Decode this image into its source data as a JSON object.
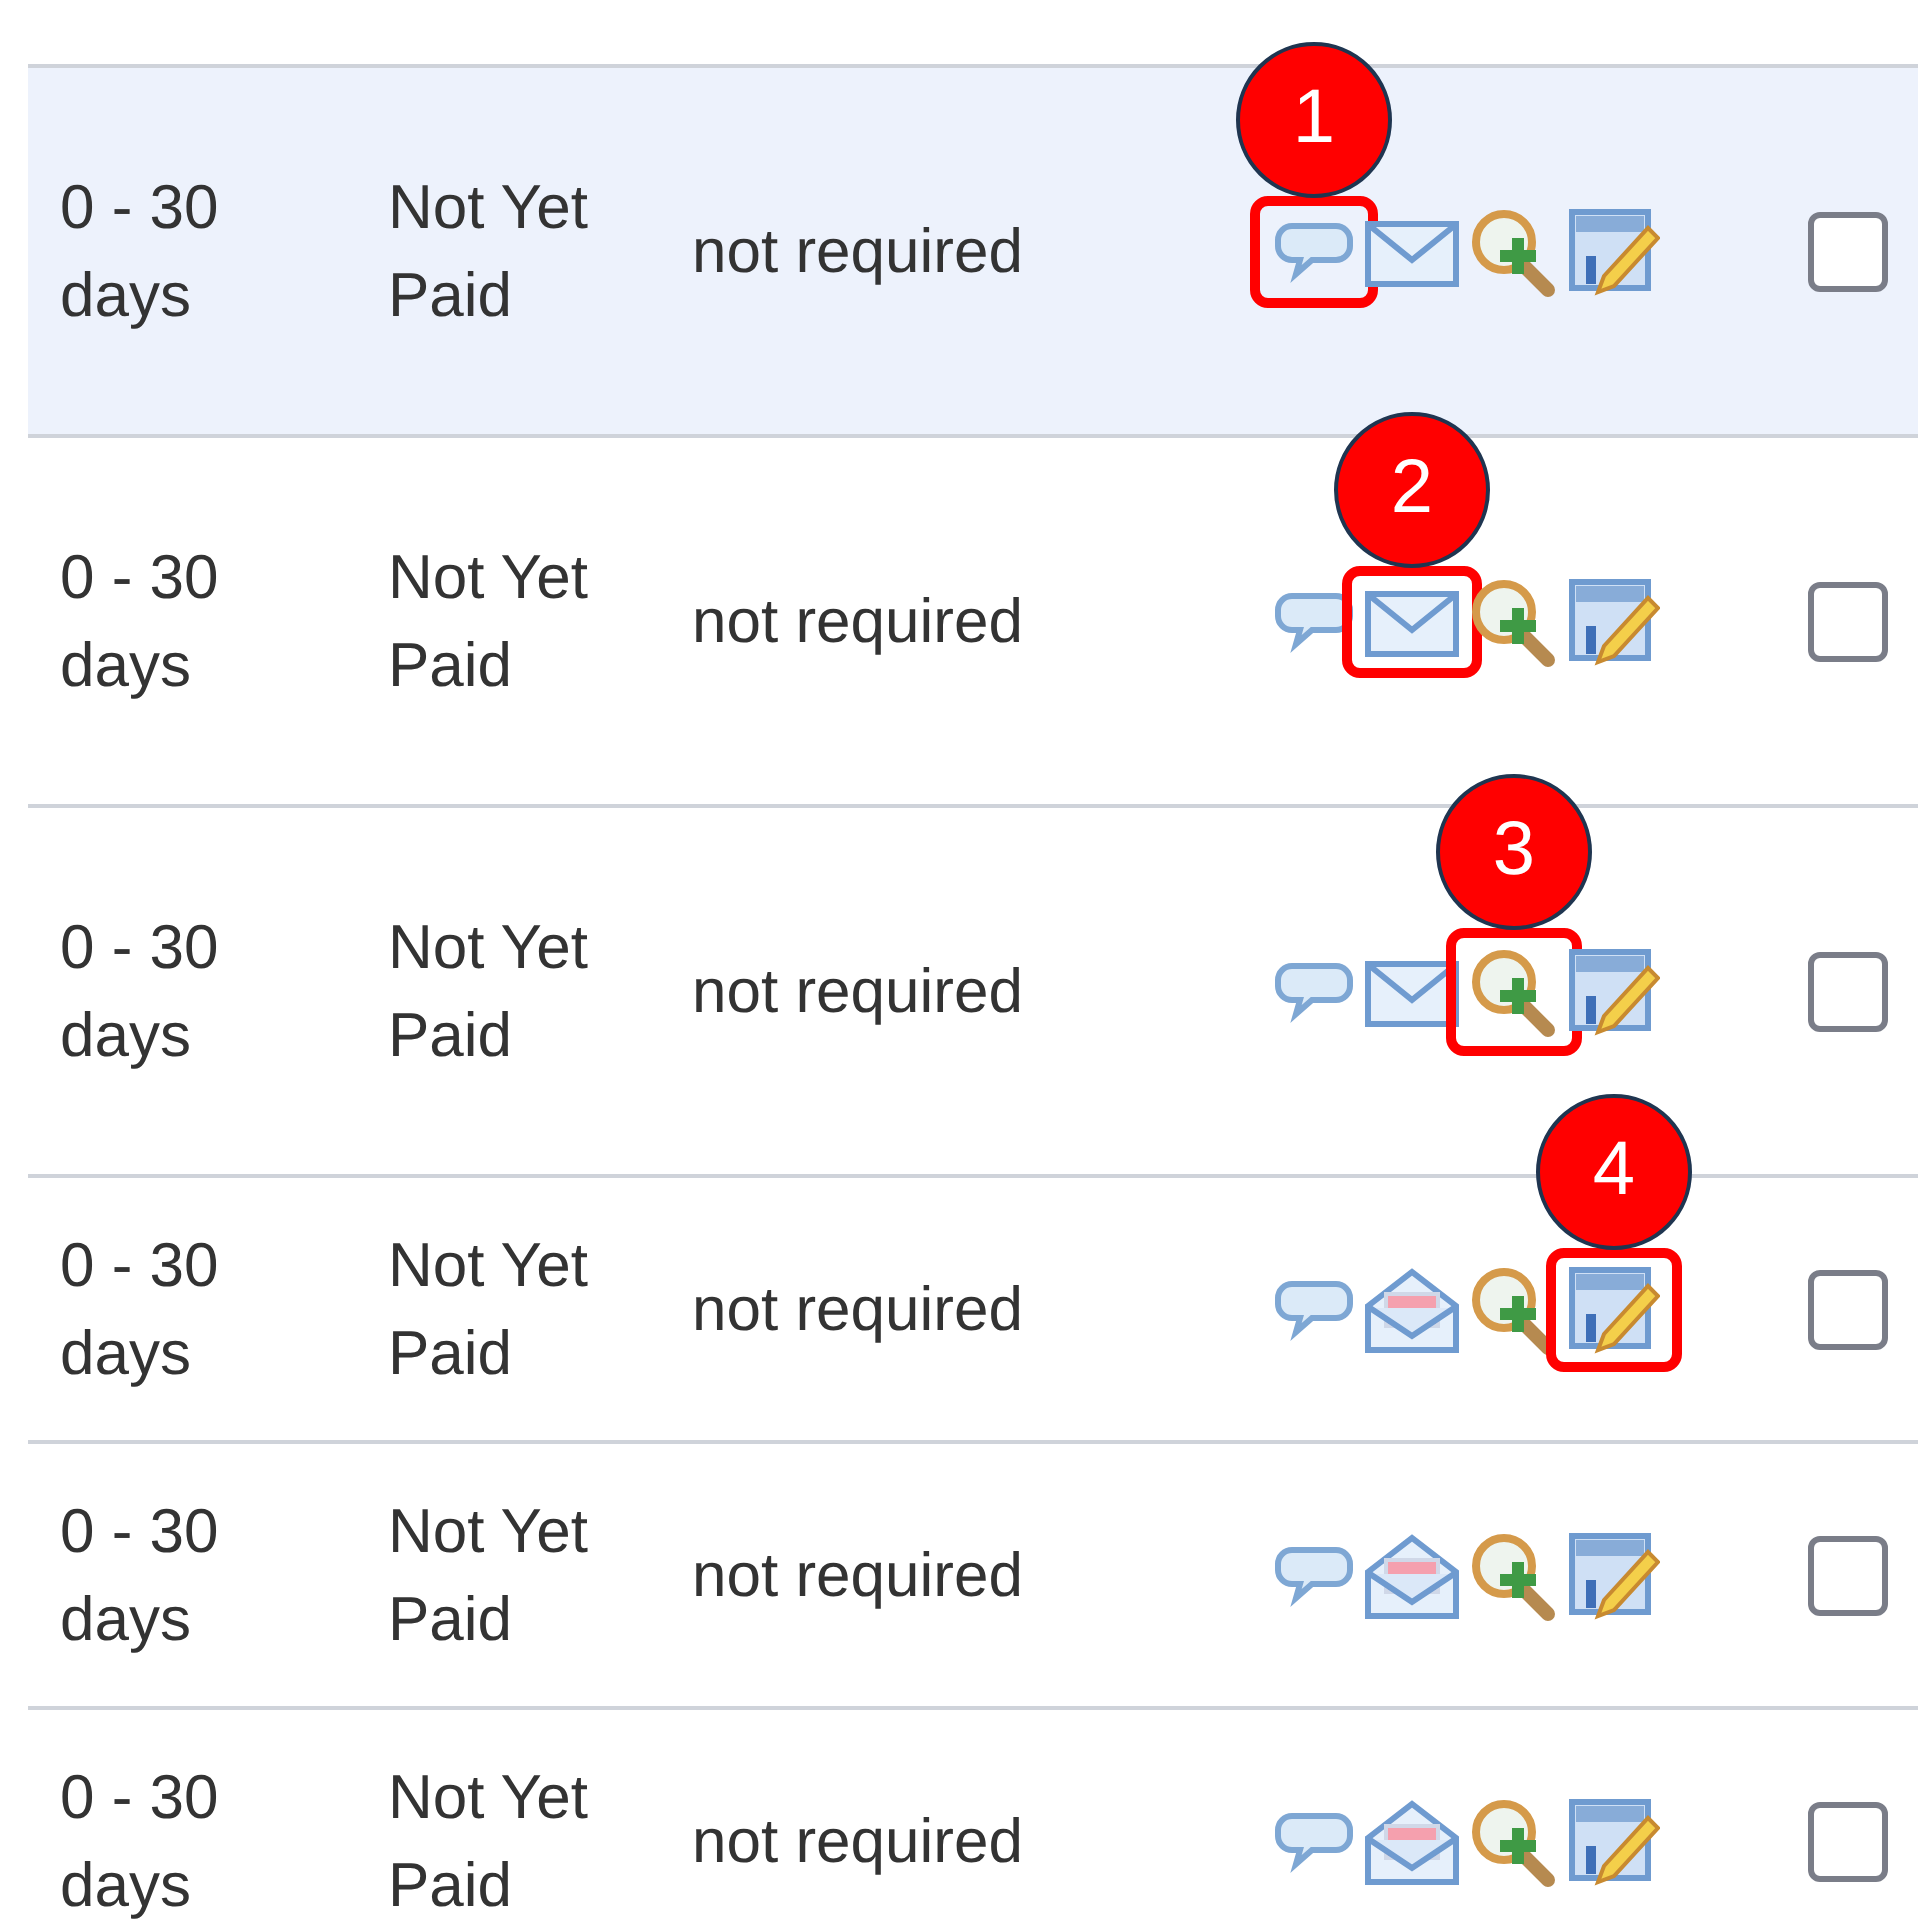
{
  "rows": [
    {
      "age": "0 - 30 days",
      "status": "Not Yet Paid",
      "approval": "not required",
      "selected": true,
      "checked": false,
      "icons": [
        {
          "kind": "comment",
          "highlighted": true,
          "callout": "1"
        },
        {
          "kind": "mail",
          "highlighted": false
        },
        {
          "kind": "zoom-add",
          "highlighted": false
        },
        {
          "kind": "edit",
          "highlighted": false
        }
      ]
    },
    {
      "age": "0 - 30 days",
      "status": "Not Yet Paid",
      "approval": "not required",
      "selected": false,
      "checked": false,
      "icons": [
        {
          "kind": "comment",
          "highlighted": false
        },
        {
          "kind": "mail",
          "highlighted": true,
          "callout": "2"
        },
        {
          "kind": "zoom-add",
          "highlighted": false
        },
        {
          "kind": "edit",
          "highlighted": false
        }
      ]
    },
    {
      "age": "0 - 30 days",
      "status": "Not Yet Paid",
      "approval": "not required",
      "selected": false,
      "checked": false,
      "icons": [
        {
          "kind": "comment",
          "highlighted": false
        },
        {
          "kind": "mail",
          "highlighted": false
        },
        {
          "kind": "zoom-add",
          "highlighted": true,
          "callout": "3"
        },
        {
          "kind": "edit",
          "highlighted": false
        }
      ]
    },
    {
      "age": "0 - 30 days",
      "status": "Not Yet Paid",
      "approval": "not required",
      "selected": false,
      "checked": false,
      "icons": [
        {
          "kind": "comment",
          "highlighted": false
        },
        {
          "kind": "mail-open",
          "highlighted": false
        },
        {
          "kind": "zoom-add",
          "highlighted": false
        },
        {
          "kind": "edit",
          "highlighted": true,
          "callout": "4"
        }
      ]
    },
    {
      "age": "0 - 30 days",
      "status": "Not Yet Paid",
      "approval": "not required",
      "selected": false,
      "checked": false,
      "icons": [
        {
          "kind": "comment",
          "highlighted": false
        },
        {
          "kind": "mail-open",
          "highlighted": false
        },
        {
          "kind": "zoom-add",
          "highlighted": false
        },
        {
          "kind": "edit",
          "highlighted": false
        }
      ]
    },
    {
      "age": "0 - 30 days",
      "status": "Not Yet Paid",
      "approval": "not required",
      "selected": false,
      "checked": false,
      "icons": [
        {
          "kind": "comment",
          "highlighted": false
        },
        {
          "kind": "mail-open",
          "highlighted": false
        },
        {
          "kind": "zoom-add",
          "highlighted": false
        },
        {
          "kind": "edit",
          "highlighted": false
        }
      ]
    }
  ]
}
